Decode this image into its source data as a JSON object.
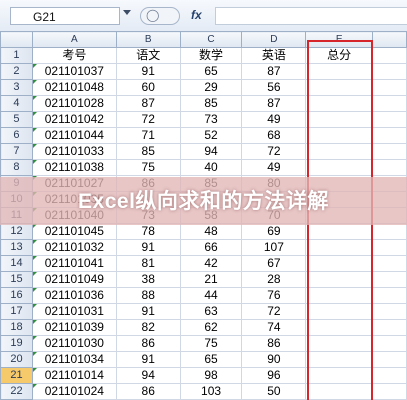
{
  "formula_bar": {
    "name_box": "G21",
    "fx_label": "fx",
    "formula": ""
  },
  "columns": [
    "A",
    "B",
    "C",
    "D",
    "E"
  ],
  "headers": [
    "考号",
    "语文",
    "数学",
    "英语",
    "总分"
  ],
  "rows": [
    {
      "num": "2",
      "id": "021101037",
      "yuwen": "91",
      "shuxue": "65",
      "yingyu": "87"
    },
    {
      "num": "3",
      "id": "021101048",
      "yuwen": "60",
      "shuxue": "29",
      "yingyu": "56"
    },
    {
      "num": "4",
      "id": "021101028",
      "yuwen": "87",
      "shuxue": "85",
      "yingyu": "87"
    },
    {
      "num": "5",
      "id": "021101042",
      "yuwen": "72",
      "shuxue": "73",
      "yingyu": "49"
    },
    {
      "num": "6",
      "id": "021101044",
      "yuwen": "71",
      "shuxue": "52",
      "yingyu": "68"
    },
    {
      "num": "7",
      "id": "021101033",
      "yuwen": "85",
      "shuxue": "94",
      "yingyu": "72"
    },
    {
      "num": "8",
      "id": "021101038",
      "yuwen": "75",
      "shuxue": "40",
      "yingyu": "49"
    },
    {
      "num": "9",
      "id": "021101027",
      "yuwen": "86",
      "shuxue": "85",
      "yingyu": "80"
    },
    {
      "num": "10",
      "id": "021101035",
      "yuwen": "",
      "shuxue": "",
      "yingyu": ""
    },
    {
      "num": "11",
      "id": "021101040",
      "yuwen": "73",
      "shuxue": "58",
      "yingyu": "70"
    },
    {
      "num": "12",
      "id": "021101045",
      "yuwen": "78",
      "shuxue": "48",
      "yingyu": "69"
    },
    {
      "num": "13",
      "id": "021101032",
      "yuwen": "91",
      "shuxue": "66",
      "yingyu": "107"
    },
    {
      "num": "14",
      "id": "021101041",
      "yuwen": "81",
      "shuxue": "42",
      "yingyu": "67"
    },
    {
      "num": "15",
      "id": "021101049",
      "yuwen": "38",
      "shuxue": "21",
      "yingyu": "28"
    },
    {
      "num": "16",
      "id": "021101036",
      "yuwen": "88",
      "shuxue": "44",
      "yingyu": "76"
    },
    {
      "num": "17",
      "id": "021101031",
      "yuwen": "91",
      "shuxue": "63",
      "yingyu": "72"
    },
    {
      "num": "18",
      "id": "021101039",
      "yuwen": "82",
      "shuxue": "62",
      "yingyu": "74"
    },
    {
      "num": "19",
      "id": "021101030",
      "yuwen": "86",
      "shuxue": "75",
      "yingyu": "86"
    },
    {
      "num": "20",
      "id": "021101034",
      "yuwen": "91",
      "shuxue": "65",
      "yingyu": "90"
    },
    {
      "num": "21",
      "id": "021101014",
      "yuwen": "94",
      "shuxue": "98",
      "yingyu": "96"
    },
    {
      "num": "22",
      "id": "021101024",
      "yuwen": "86",
      "shuxue": "103",
      "yingyu": "50"
    }
  ],
  "selected_row": "21",
  "overlay_title": "Excel纵向求和的方法详解",
  "colors": {
    "highlight": "#d6252b",
    "banner": "#e2b6b6",
    "selected_row_header": "#f6c96b"
  }
}
